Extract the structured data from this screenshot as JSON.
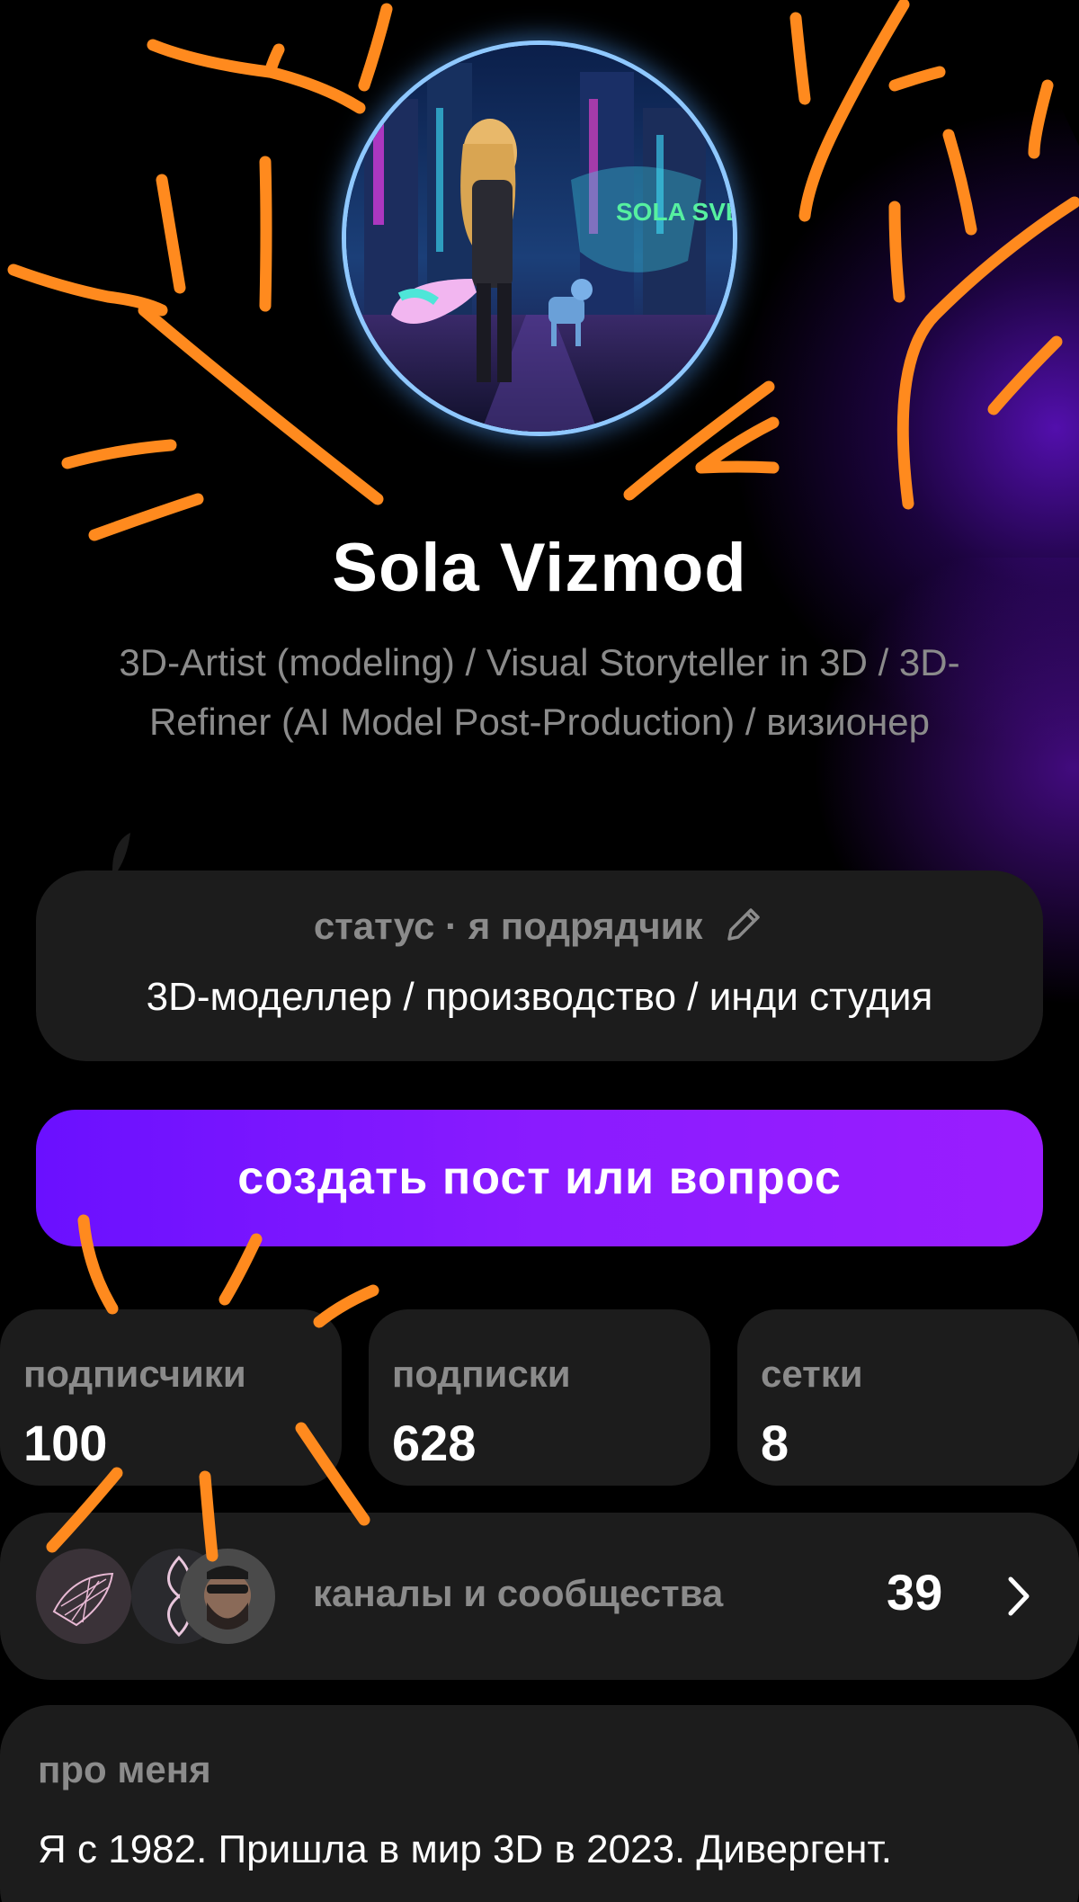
{
  "profile": {
    "name": "Sola Vizmod",
    "subtitle": "3D-Artist (modeling) / Visual Storyteller in 3D / 3D-Refiner (AI Model Post-Production) / визионер",
    "avatar_text": "SOLA SVET"
  },
  "status": {
    "header": "статус · я подрядчик",
    "body": "3D-моделлер / производство / инди студия"
  },
  "cta": {
    "label": "создать пост или вопрос"
  },
  "stats": [
    {
      "label": "подписчики",
      "value": "100"
    },
    {
      "label": "подписки",
      "value": "628"
    },
    {
      "label": "сетки",
      "value": "8"
    }
  ],
  "channels": {
    "label": "каналы и сообщества",
    "count": "39"
  },
  "about": {
    "header": "про меня",
    "text": "Я с 1982. Пришла в мир 3D в 2023. Дивергент."
  },
  "colors": {
    "accent": "#7b12ff",
    "card": "#1c1c1c",
    "muted_text": "#8b8b8b",
    "annotation": "#ff8a1e"
  },
  "icons": {
    "status_edit": "pencil-icon",
    "channels_more": "chevron-right-icon"
  }
}
